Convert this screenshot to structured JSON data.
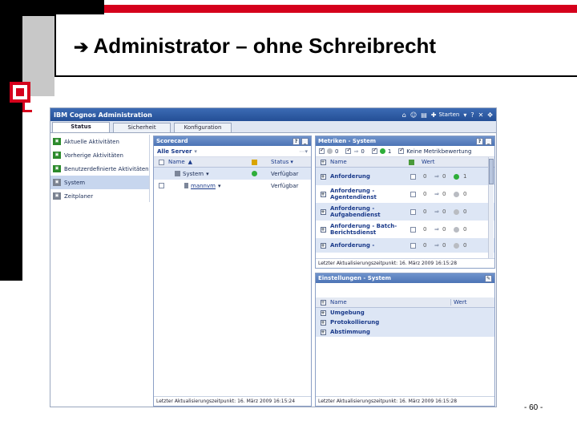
{
  "slide": {
    "title": "Administrator – ohne Schreibrecht",
    "title_arrow_icon": "arrow-right-icon",
    "page_number": "- 60 -",
    "colors": {
      "accent_red": "#d5001c",
      "black": "#000000"
    }
  },
  "app": {
    "title": "IBM Cognos Administration",
    "header_start_label": "Starten",
    "tabs": [
      {
        "label": "Status",
        "active": true
      },
      {
        "label": "Sicherheit",
        "active": false
      },
      {
        "label": "Konfiguration",
        "active": false
      }
    ],
    "nav": [
      {
        "label": "Aktuelle Aktivitäten",
        "icon": "activity-icon"
      },
      {
        "label": "Vorherige Aktivitäten",
        "icon": "history-icon"
      },
      {
        "label": "Benutzerdefinierte Aktivitäten",
        "icon": "scheduled-icon"
      },
      {
        "label": "System",
        "icon": "system-icon",
        "selected": true
      },
      {
        "label": "Zeitplaner",
        "icon": "scheduler-icon"
      }
    ]
  },
  "scorecard": {
    "title": "Scorecard",
    "filter_label": "Alle Server",
    "columns": {
      "name": "Name",
      "status": "Status"
    },
    "rows": [
      {
        "name": "System",
        "status": "Verfügbar",
        "dot": "green"
      },
      {
        "name": "mannvm",
        "status": "Verfügbar",
        "dot": "none"
      }
    ],
    "footer": "Letzter Aktualisierungszeitpunkt: 16. März 2009 16:15:24"
  },
  "metrics": {
    "title": "Metriken - System",
    "filter": {
      "count_a": "0",
      "count_b": "0",
      "count_c": "1",
      "no_eval": "Keine Metrikbewertung"
    },
    "columns": {
      "name": "Name",
      "value": "Wert"
    },
    "rows": [
      {
        "name": "Anforderung",
        "name2": "",
        "v1": "0",
        "v2": "0",
        "v3": "1",
        "dot": "green"
      },
      {
        "name": "Anforderung -",
        "name2": "Agentendienst",
        "v1": "0",
        "v2": "0",
        "v3": "0",
        "dot": "gray"
      },
      {
        "name": "Anforderung -",
        "name2": "Aufgabendienst",
        "v1": "0",
        "v2": "0",
        "v3": "0",
        "dot": "gray"
      },
      {
        "name": "Anforderung - Batch-",
        "name2": "Berichtsdienst",
        "v1": "0",
        "v2": "0",
        "v3": "0",
        "dot": "gray"
      },
      {
        "name": "Anforderung -",
        "name2": "",
        "v1": "0",
        "v2": "0",
        "v3": "0",
        "dot": "gray"
      }
    ],
    "footer": "Letzter Aktualisierungszeitpunkt: 16. März 2009 16:15:28"
  },
  "settings": {
    "title": "Einstellungen - System",
    "columns": {
      "name": "Name",
      "value": "Wert"
    },
    "rows": [
      {
        "name": "Umgebung"
      },
      {
        "name": "Protokollierung"
      },
      {
        "name": "Abstimmung"
      }
    ],
    "footer": "Letzter Aktualisierungszeitpunkt: 16. März 2009 16:15:28"
  }
}
